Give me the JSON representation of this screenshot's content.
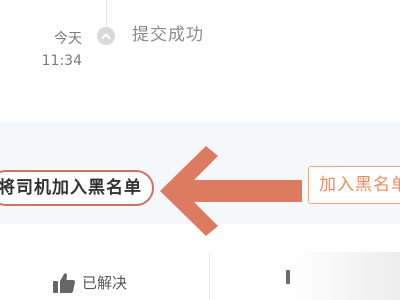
{
  "timeline": {
    "date": "今天",
    "time": "11:34",
    "status": "提交成功"
  },
  "blacklist": {
    "driver_button_label": "将司机加入黑名单",
    "add_button_label": "加入黑名单"
  },
  "footer": {
    "solved_label": "已解决"
  },
  "colors": {
    "accent": "#ef8a62",
    "annotation": "#dd7a62",
    "band_bg": "#f6f7fb"
  },
  "icons": {
    "timeline_node": "chevron-up-icon",
    "solved": "thumbs-up-icon",
    "annotation": "left-arrow-icon"
  }
}
